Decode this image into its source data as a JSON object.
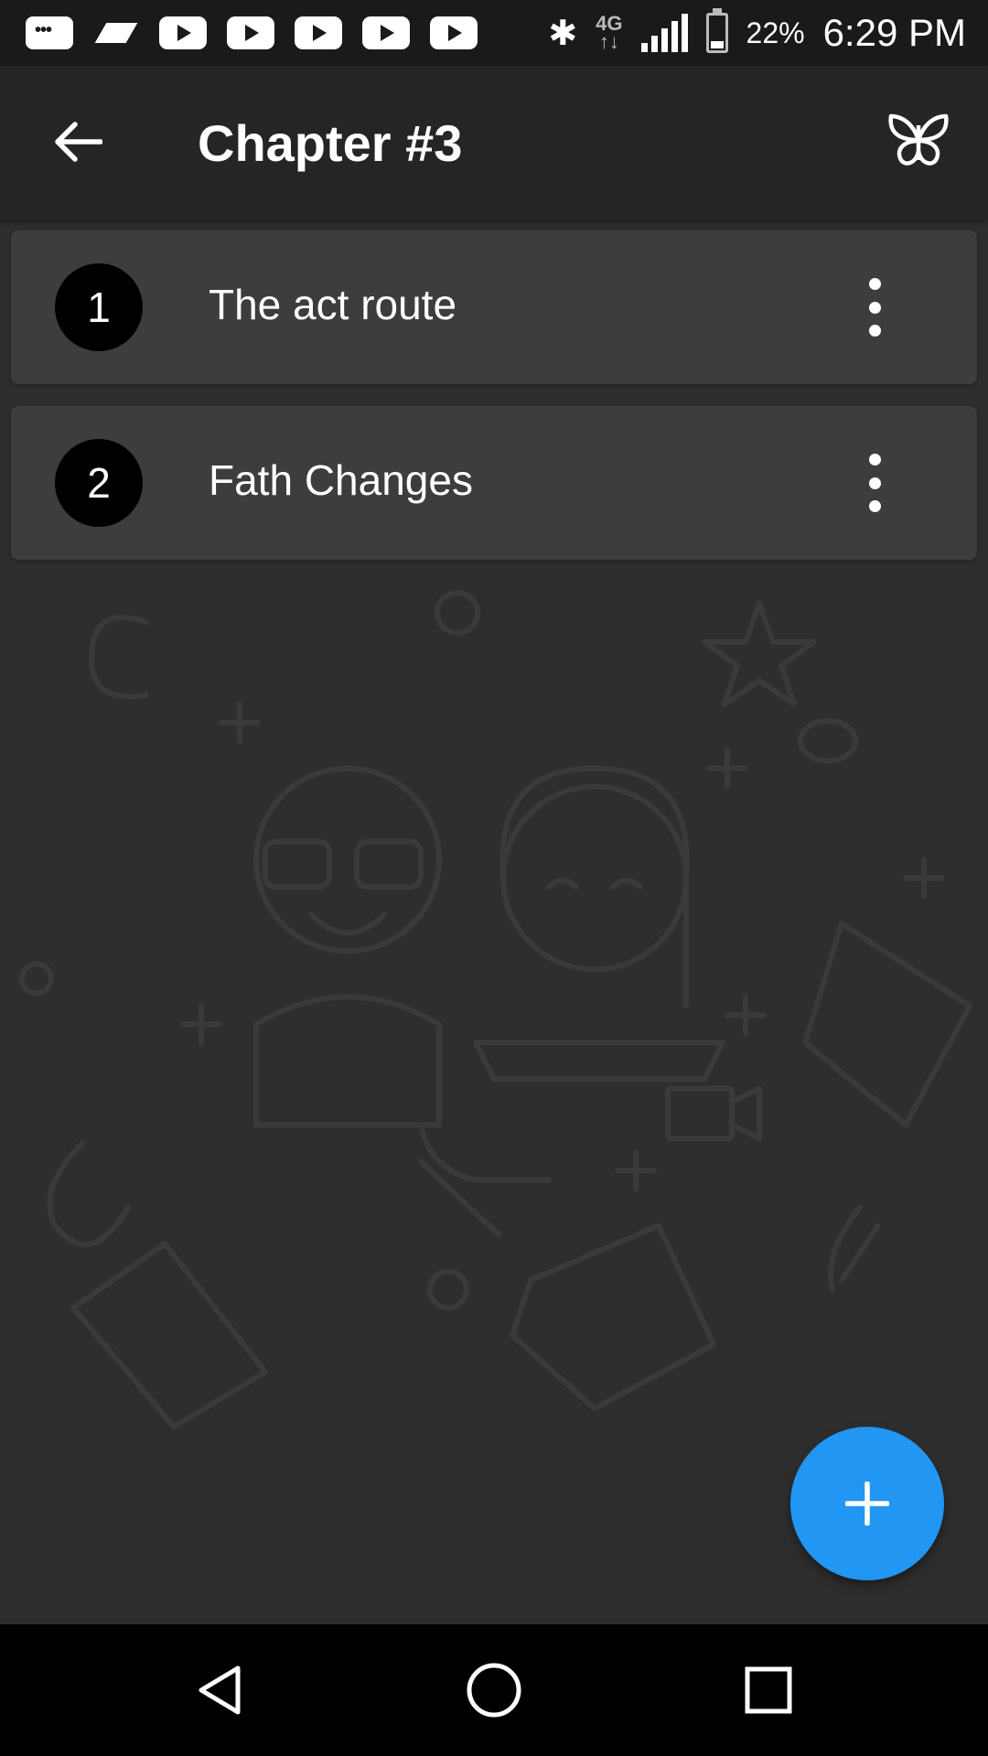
{
  "status_bar": {
    "icons_left": [
      "message-icon",
      "notification-icon",
      "youtube-icon",
      "youtube-icon",
      "youtube-icon",
      "youtube-icon",
      "youtube-icon"
    ],
    "bluetooth": "bluetooth-icon",
    "network_type": "4G",
    "battery_percent": "22%",
    "battery_level": 0.22,
    "time": "6:29 PM"
  },
  "app_bar": {
    "title": "Chapter #3",
    "back_icon": "arrow-back-icon",
    "action_icon": "butterfly-icon"
  },
  "list": {
    "items": [
      {
        "number": "1",
        "title": "The act route"
      },
      {
        "number": "2",
        "title": "Fath Changes"
      }
    ]
  },
  "fab": {
    "icon": "plus-icon"
  },
  "nav_bar": {
    "back": "nav-back-icon",
    "home": "nav-home-icon",
    "recents": "nav-recents-icon"
  },
  "colors": {
    "background": "#2e2e2e",
    "app_bar": "#252525",
    "card": "#3d3d3d",
    "accent": "#2196f3"
  }
}
